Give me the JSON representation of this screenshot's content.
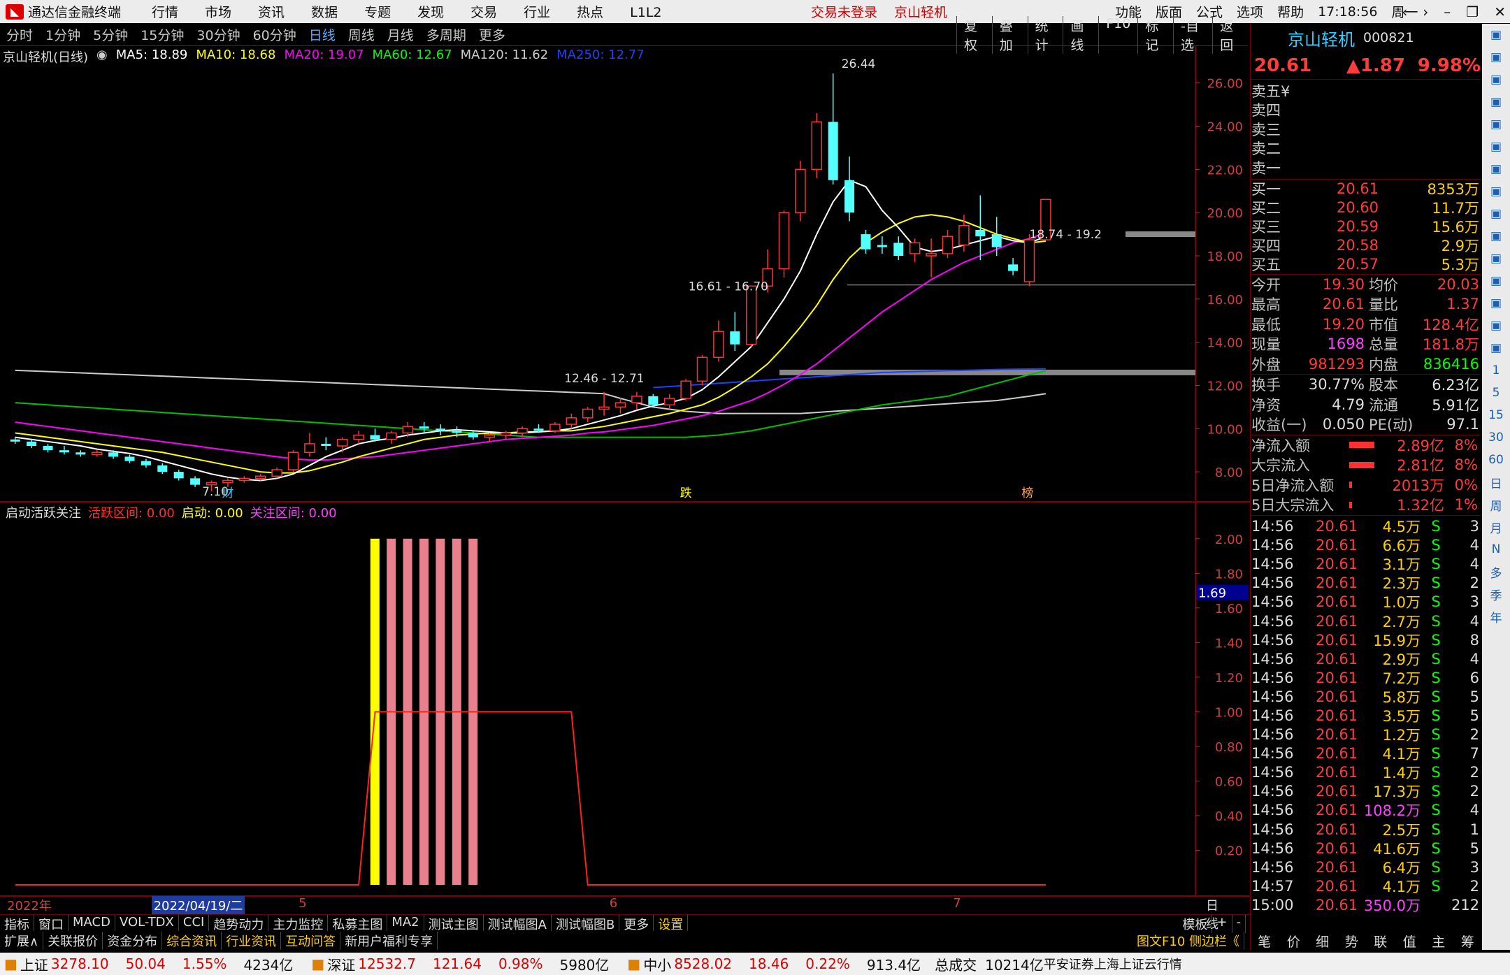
{
  "app": {
    "title": "通达信金融终端",
    "menu": [
      "行情",
      "市场",
      "资讯",
      "数据",
      "专题",
      "发现",
      "交易",
      "行业",
      "热点",
      "L1L2"
    ],
    "center": [
      "交易未登录",
      "京山轻机"
    ],
    "right": [
      "功能",
      "版面",
      "公式",
      "选项",
      "帮助"
    ],
    "time": "17:18:56",
    "weekday": "周一"
  },
  "periods": [
    "分时",
    "1分钟",
    "5分钟",
    "15分钟",
    "30分钟",
    "60分钟",
    "日线",
    "周线",
    "月线",
    "多周期",
    "更多"
  ],
  "active_period": "日线",
  "tools": [
    "复权",
    "叠加",
    "统计",
    "画线",
    "F10",
    "标记",
    "-自选",
    "返回"
  ],
  "ma": {
    "name": "京山轻机(日线)",
    "items": [
      {
        "label": "MA5: 18.89",
        "color": "#ffffff"
      },
      {
        "label": "MA10: 18.68",
        "color": "#ffff00"
      },
      {
        "label": "MA20: 19.07",
        "color": "#ff00ff"
      },
      {
        "label": "MA60: 12.67",
        "color": "#00ff00"
      },
      {
        "label": "MA120: 11.62",
        "color": "#cccccc"
      },
      {
        "label": "MA250: 12.77",
        "color": "#2040ff"
      }
    ]
  },
  "chart_data": {
    "type": "candlestick",
    "ylim": [
      7.0,
      26.8
    ],
    "yticks": [
      "26.00",
      "24.00",
      "22.00",
      "20.00",
      "18.00",
      "16.00",
      "14.00",
      "12.00",
      "10.00",
      "8.00"
    ],
    "annotations": [
      "26.44",
      "7.10",
      "16.61 - 16.70",
      "12.46 - 12.71",
      "18.74 - 19.2"
    ],
    "markers": [
      "财",
      "跌",
      "榜"
    ],
    "candles": [
      [
        9.5,
        9.6,
        9.3,
        9.4
      ],
      [
        9.4,
        9.5,
        9.1,
        9.2
      ],
      [
        9.2,
        9.3,
        8.9,
        9.0
      ],
      [
        9.0,
        9.2,
        8.8,
        8.9
      ],
      [
        8.9,
        9.0,
        8.7,
        8.8
      ],
      [
        8.8,
        9.0,
        8.7,
        8.9
      ],
      [
        8.9,
        9.0,
        8.6,
        8.7
      ],
      [
        8.7,
        8.8,
        8.4,
        8.5
      ],
      [
        8.5,
        8.6,
        8.2,
        8.3
      ],
      [
        8.3,
        8.4,
        7.9,
        8.0
      ],
      [
        8.0,
        8.1,
        7.6,
        7.7
      ],
      [
        7.7,
        7.8,
        7.3,
        7.4
      ],
      [
        7.4,
        7.6,
        7.1,
        7.5
      ],
      [
        7.5,
        7.7,
        7.3,
        7.6
      ],
      [
        7.6,
        7.8,
        7.5,
        7.7
      ],
      [
        7.7,
        7.9,
        7.6,
        7.8
      ],
      [
        7.8,
        8.2,
        7.7,
        8.1
      ],
      [
        8.1,
        9.0,
        8.0,
        8.9
      ],
      [
        8.9,
        9.8,
        8.7,
        9.3
      ],
      [
        9.3,
        9.6,
        9.0,
        9.2
      ],
      [
        9.2,
        9.6,
        8.9,
        9.5
      ],
      [
        9.5,
        9.9,
        9.3,
        9.7
      ],
      [
        9.7,
        10.0,
        9.4,
        9.5
      ],
      [
        9.5,
        9.9,
        9.3,
        9.8
      ],
      [
        9.8,
        10.3,
        9.6,
        10.1
      ],
      [
        10.1,
        10.3,
        9.8,
        10.0
      ],
      [
        10.0,
        10.2,
        9.7,
        9.9
      ],
      [
        9.9,
        10.1,
        9.6,
        9.8
      ],
      [
        9.8,
        9.9,
        9.5,
        9.6
      ],
      [
        9.6,
        9.8,
        9.4,
        9.7
      ],
      [
        9.7,
        9.9,
        9.5,
        9.8
      ],
      [
        9.8,
        10.1,
        9.6,
        10.0
      ],
      [
        10.0,
        10.2,
        9.8,
        9.9
      ],
      [
        9.9,
        10.3,
        9.8,
        10.2
      ],
      [
        10.2,
        10.7,
        10.0,
        10.5
      ],
      [
        10.5,
        11.0,
        10.3,
        10.9
      ],
      [
        10.9,
        11.7,
        10.6,
        11.0
      ],
      [
        11.0,
        11.4,
        10.7,
        11.2
      ],
      [
        11.2,
        11.7,
        10.9,
        11.5
      ],
      [
        11.5,
        11.6,
        11.0,
        11.1
      ],
      [
        11.1,
        11.6,
        10.9,
        11.4
      ],
      [
        11.4,
        12.3,
        11.3,
        12.2
      ],
      [
        12.2,
        13.4,
        12.0,
        13.3
      ],
      [
        13.3,
        15.0,
        13.1,
        14.5
      ],
      [
        14.5,
        15.4,
        13.6,
        13.9
      ],
      [
        13.9,
        16.6,
        13.8,
        16.6
      ],
      [
        16.6,
        18.3,
        16.3,
        17.4
      ],
      [
        17.4,
        20.1,
        17.0,
        20.0
      ],
      [
        20.0,
        22.4,
        19.6,
        22.0
      ],
      [
        22.0,
        24.6,
        21.6,
        24.2
      ],
      [
        24.2,
        26.44,
        21.3,
        21.5
      ],
      [
        21.5,
        22.6,
        19.6,
        20.0
      ],
      [
        19.0,
        19.2,
        18.1,
        18.3
      ],
      [
        18.5,
        18.9,
        18.1,
        18.4
      ],
      [
        18.6,
        18.9,
        17.8,
        18.0
      ],
      [
        18.1,
        18.8,
        17.7,
        18.6
      ],
      [
        18.0,
        18.8,
        17.0,
        18.1
      ],
      [
        18.1,
        19.2,
        17.9,
        18.9
      ],
      [
        18.5,
        19.9,
        18.2,
        19.4
      ],
      [
        19.2,
        20.8,
        17.8,
        18.9
      ],
      [
        19.0,
        19.8,
        18.0,
        18.4
      ],
      [
        17.6,
        17.9,
        17.1,
        17.3
      ],
      [
        16.8,
        19.0,
        16.6,
        18.74
      ],
      [
        18.74,
        20.61,
        18.7,
        20.61
      ]
    ],
    "ma5": [
      9.6,
      9.5,
      9.4,
      9.3,
      9.2,
      9.05,
      8.95,
      8.85,
      8.7,
      8.5,
      8.3,
      8.1,
      7.9,
      7.75,
      7.65,
      7.6,
      7.7,
      7.9,
      8.3,
      8.7,
      9.0,
      9.3,
      9.45,
      9.55,
      9.7,
      9.8,
      9.9,
      9.95,
      9.9,
      9.85,
      9.8,
      9.8,
      9.85,
      9.9,
      10.0,
      10.2,
      10.4,
      10.6,
      10.85,
      11.05,
      11.2,
      11.4,
      11.8,
      12.4,
      13.1,
      13.8,
      14.9,
      16.0,
      17.3,
      19.0,
      20.5,
      21.5,
      21.2,
      20.1,
      19.3,
      18.4,
      18.2,
      18.3,
      18.5,
      18.7,
      18.9,
      18.7,
      18.6,
      18.89
    ],
    "ma10": [
      9.8,
      9.7,
      9.6,
      9.5,
      9.4,
      9.3,
      9.2,
      9.1,
      9.0,
      8.9,
      8.75,
      8.6,
      8.45,
      8.3,
      8.15,
      8.0,
      7.95,
      7.95,
      8.05,
      8.25,
      8.45,
      8.7,
      8.9,
      9.1,
      9.3,
      9.5,
      9.6,
      9.7,
      9.75,
      9.8,
      9.8,
      9.85,
      9.85,
      9.9,
      9.9,
      10.0,
      10.1,
      10.25,
      10.4,
      10.55,
      10.7,
      10.9,
      11.1,
      11.45,
      11.9,
      12.4,
      13.0,
      13.8,
      14.7,
      15.7,
      16.9,
      17.9,
      18.6,
      19.1,
      19.5,
      19.8,
      19.9,
      19.8,
      19.6,
      19.3,
      19.0,
      18.8,
      18.6,
      18.68
    ],
    "ma20": [
      10.3,
      10.2,
      10.1,
      10.0,
      9.9,
      9.8,
      9.7,
      9.6,
      9.5,
      9.4,
      9.3,
      9.2,
      9.1,
      9.0,
      8.9,
      8.8,
      8.7,
      8.6,
      8.55,
      8.55,
      8.6,
      8.65,
      8.7,
      8.8,
      8.9,
      9.0,
      9.1,
      9.2,
      9.3,
      9.4,
      9.5,
      9.55,
      9.6,
      9.65,
      9.7,
      9.8,
      9.85,
      9.95,
      10.05,
      10.15,
      10.3,
      10.45,
      10.6,
      10.8,
      11.05,
      11.3,
      11.65,
      12.05,
      12.5,
      13.0,
      13.6,
      14.2,
      14.8,
      15.4,
      15.9,
      16.4,
      16.9,
      17.3,
      17.7,
      18.0,
      18.3,
      18.6,
      18.8,
      19.07
    ],
    "ma60": [
      11.2,
      11.15,
      11.1,
      11.05,
      11.0,
      10.95,
      10.9,
      10.85,
      10.8,
      10.75,
      10.7,
      10.65,
      10.6,
      10.55,
      10.5,
      10.45,
      10.4,
      10.35,
      10.3,
      10.25,
      10.2,
      10.15,
      10.1,
      10.05,
      10.0,
      9.95,
      9.9,
      9.85,
      9.8,
      9.75,
      9.7,
      9.65,
      9.6,
      9.6,
      9.6,
      9.6,
      9.6,
      9.6,
      9.6,
      9.6,
      9.6,
      9.6,
      9.65,
      9.7,
      9.8,
      9.9,
      10.05,
      10.2,
      10.35,
      10.5,
      10.65,
      10.8,
      10.95,
      11.1,
      11.2,
      11.3,
      11.4,
      11.5,
      11.7,
      11.9,
      12.1,
      12.3,
      12.5,
      12.67
    ],
    "ma120": [
      12.7,
      12.67,
      12.64,
      12.61,
      12.58,
      12.55,
      12.52,
      12.49,
      12.46,
      12.43,
      12.4,
      12.37,
      12.34,
      12.31,
      12.28,
      12.25,
      12.22,
      12.19,
      12.16,
      12.13,
      12.1,
      12.07,
      12.04,
      12.01,
      11.98,
      11.95,
      11.92,
      11.89,
      11.86,
      11.83,
      11.8,
      11.77,
      11.74,
      11.71,
      11.68,
      11.65,
      11.62,
      11.4,
      11.2,
      11.0,
      10.9,
      10.8,
      10.75,
      10.7,
      10.7,
      10.7,
      10.7,
      10.7,
      10.7,
      10.75,
      10.8,
      10.85,
      10.9,
      10.95,
      11.0,
      11.05,
      11.1,
      11.15,
      11.2,
      11.25,
      11.3,
      11.4,
      11.5,
      11.62
    ],
    "ma250": [
      null,
      null,
      null,
      null,
      null,
      null,
      null,
      null,
      null,
      null,
      null,
      null,
      null,
      null,
      null,
      null,
      null,
      null,
      null,
      null,
      null,
      null,
      null,
      null,
      null,
      null,
      null,
      null,
      null,
      null,
      null,
      null,
      null,
      null,
      null,
      null,
      null,
      null,
      null,
      11.9,
      11.95,
      12.0,
      12.05,
      12.1,
      12.15,
      12.2,
      12.25,
      12.3,
      12.35,
      12.4,
      12.45,
      12.5,
      12.55,
      12.6,
      12.62,
      12.64,
      12.66,
      12.68,
      12.7,
      12.72,
      12.74,
      12.75,
      12.76,
      12.77
    ],
    "indicator": {
      "name": "启动活跃关注",
      "labels": [
        {
          "label": "活跃区间: 0.00",
          "color": "#ff3030"
        },
        {
          "label": "启动: 0.00",
          "color": "#ffff00"
        },
        {
          "label": "关注区间: 0.00",
          "color": "#ff40ff"
        }
      ],
      "yticks": [
        "2.00",
        "1.80",
        "1.60",
        "1.40",
        "1.20",
        "1.00",
        "0.80",
        "0.60",
        "0.40",
        "0.20"
      ],
      "cursor": "1.69",
      "bars": [
        {
          "i": 22,
          "color": "#ffff00"
        },
        {
          "i": 23,
          "color": "#e8808e"
        },
        {
          "i": 24,
          "color": "#e8808e"
        },
        {
          "i": 25,
          "color": "#e8808e"
        },
        {
          "i": 26,
          "color": "#e8808e"
        },
        {
          "i": 27,
          "color": "#e8808e"
        },
        {
          "i": 28,
          "color": "#e8808e"
        }
      ],
      "step": [
        [
          0,
          0
        ],
        [
          21,
          0
        ],
        [
          22,
          1
        ],
        [
          34,
          1
        ],
        [
          35,
          0
        ],
        [
          63,
          0
        ]
      ]
    },
    "dates": [
      {
        "label": "2022年",
        "i": 0
      },
      {
        "label": "2022/04/19/二",
        "i": 9
      },
      {
        "label": "5",
        "i": 18
      },
      {
        "label": "6",
        "i": 37
      },
      {
        "label": "7",
        "i": 58
      }
    ],
    "date_label": "日线"
  },
  "bottom_tabs": [
    "指标",
    "窗口",
    "MACD",
    "VOL-TDX",
    "CCI",
    "趋势动力",
    "主力监控",
    "私募主图",
    "MA2",
    "测试主图",
    "测试幅图A",
    "测试幅图B",
    "更多",
    "设置"
  ],
  "bottom_right": [
    "模板",
    "+",
    "-"
  ],
  "tabs2": [
    "扩展∧",
    "关联报价",
    "资金分布",
    "综合资讯",
    "行业资讯",
    "互动问答",
    "新用户福利专享"
  ],
  "tabs2_right": "图文F10 侧边栏《",
  "status": {
    "sh": {
      "name": "上证",
      "v": "3278.10",
      "c": "50.04",
      "p": "1.55%",
      "a": "4234亿"
    },
    "sz": {
      "name": "深证",
      "v": "12532.7",
      "c": "121.64",
      "p": "0.98%",
      "a": "5980亿"
    },
    "zx": {
      "name": "中小",
      "v": "8528.02",
      "c": "18.46",
      "p": "0.22%",
      "a": "913.4亿"
    },
    "total": "总成交",
    "total_v": "10214亿",
    "src": "平安证券上海上证云行情"
  },
  "quote": {
    "name": "京山轻机",
    "code": "000821",
    "price": "20.61",
    "change": "▲1.87",
    "pct": "9.98%",
    "sell": [
      "卖五¥",
      "卖四",
      "卖三",
      "卖二",
      "卖一"
    ],
    "buy": [
      [
        "买一",
        "20.61",
        "8353万"
      ],
      [
        "买二",
        "20.60",
        "11.7万"
      ],
      [
        "买三",
        "20.59",
        "15.6万"
      ],
      [
        "买四",
        "20.58",
        "2.9万"
      ],
      [
        "买五",
        "20.57",
        "5.3万"
      ]
    ],
    "stats": [
      [
        "今开",
        "19.30",
        "均价",
        "20.03"
      ],
      [
        "最高",
        "20.61",
        "量比",
        "1.37"
      ],
      [
        "最低",
        "19.20",
        "市值",
        "128.4亿"
      ],
      [
        "现量",
        "1698",
        "总量",
        "181.8万"
      ],
      [
        "外盘",
        "981293",
        "内盘",
        "836416"
      ]
    ],
    "stats2": [
      [
        "换手",
        "30.77%",
        "股本",
        "6.23亿"
      ],
      [
        "净资",
        "4.79",
        "流通",
        "5.91亿"
      ],
      [
        "收益(一)",
        "0.050",
        "PE(动)",
        "97.1"
      ]
    ],
    "flow": [
      [
        "净流入额",
        "2.89亿",
        "8%"
      ],
      [
        "大宗流入",
        "2.81亿",
        "8%"
      ],
      [
        "5日净流入额",
        "2013万",
        "0%"
      ],
      [
        "5日大宗流入",
        "1.32亿",
        "1%"
      ]
    ],
    "ticks": [
      [
        "14:56",
        "20.61",
        "4.5万",
        "S",
        "3"
      ],
      [
        "14:56",
        "20.61",
        "6.6万",
        "S",
        "4"
      ],
      [
        "14:56",
        "20.61",
        "3.1万",
        "S",
        "4"
      ],
      [
        "14:56",
        "20.61",
        "2.3万",
        "S",
        "2"
      ],
      [
        "14:56",
        "20.61",
        "1.0万",
        "S",
        "3"
      ],
      [
        "14:56",
        "20.61",
        "2.7万",
        "S",
        "4"
      ],
      [
        "14:56",
        "20.61",
        "15.9万",
        "S",
        "8"
      ],
      [
        "14:56",
        "20.61",
        "2.9万",
        "S",
        "4"
      ],
      [
        "14:56",
        "20.61",
        "7.2万",
        "S",
        "6"
      ],
      [
        "14:56",
        "20.61",
        "5.8万",
        "S",
        "5"
      ],
      [
        "14:56",
        "20.61",
        "3.5万",
        "S",
        "5"
      ],
      [
        "14:56",
        "20.61",
        "1.2万",
        "S",
        "2"
      ],
      [
        "14:56",
        "20.61",
        "4.1万",
        "S",
        "7"
      ],
      [
        "14:56",
        "20.61",
        "1.4万",
        "S",
        "2"
      ],
      [
        "14:56",
        "20.61",
        "17.3万",
        "S",
        "2"
      ],
      [
        "14:56",
        "20.61",
        "108.2万",
        "S",
        "4"
      ],
      [
        "14:56",
        "20.61",
        "2.5万",
        "S",
        "1"
      ],
      [
        "14:56",
        "20.61",
        "41.6万",
        "S",
        "5"
      ],
      [
        "14:56",
        "20.61",
        "6.4万",
        "S",
        "3"
      ],
      [
        "14:57",
        "20.61",
        "4.1万",
        "S",
        "2"
      ],
      [
        "15:00",
        "20.61",
        "350.0万",
        "",
        "212"
      ]
    ],
    "tabs": [
      "笔",
      "价",
      "细",
      "势",
      "联",
      "值",
      "主",
      "筹"
    ]
  },
  "sidebar": [
    "1",
    "5",
    "15",
    "30",
    "60",
    "日",
    "周",
    "月",
    "N",
    "多",
    "季",
    "年"
  ]
}
